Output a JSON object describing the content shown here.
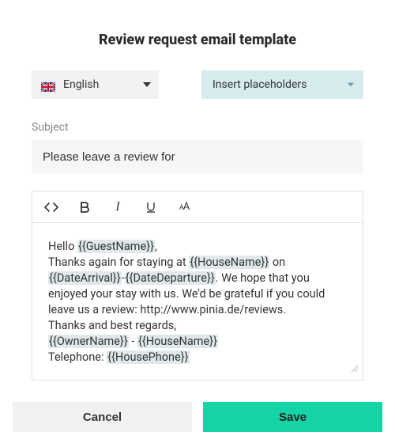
{
  "title": "Review request email template",
  "language": {
    "label": "English"
  },
  "placeholders_dropdown": {
    "label": "Insert placeholders"
  },
  "subject": {
    "label": "Subject",
    "value": "Please leave a review for"
  },
  "body": {
    "segments": [
      {
        "t": "text",
        "v": "Hello "
      },
      {
        "t": "ph",
        "v": "{{GuestName}}"
      },
      {
        "t": "text",
        "v": ","
      },
      {
        "t": "br"
      },
      {
        "t": "text",
        "v": "Thanks again for staying at "
      },
      {
        "t": "ph",
        "v": "{{HouseName}}"
      },
      {
        "t": "text",
        "v": " on "
      },
      {
        "t": "ph",
        "v": "{{DateArrival}}"
      },
      {
        "t": "text",
        "v": "-"
      },
      {
        "t": "ph",
        "v": "{{DateDeparture}}"
      },
      {
        "t": "text",
        "v": ". We hope that you enjoyed your stay with us. We'd be grateful if you could leave us a review: http://www.pinia.de/reviews."
      },
      {
        "t": "br"
      },
      {
        "t": "text",
        "v": "Thanks and best regards,"
      },
      {
        "t": "br"
      },
      {
        "t": "ph",
        "v": "{{OwnerName}}"
      },
      {
        "t": "text",
        "v": " - "
      },
      {
        "t": "ph",
        "v": "{{HouseName}}"
      },
      {
        "t": "br"
      },
      {
        "t": "text",
        "v": "Telephone: "
      },
      {
        "t": "ph",
        "v": "{{HousePhone}}"
      }
    ]
  },
  "buttons": {
    "cancel": "Cancel",
    "save": "Save"
  }
}
